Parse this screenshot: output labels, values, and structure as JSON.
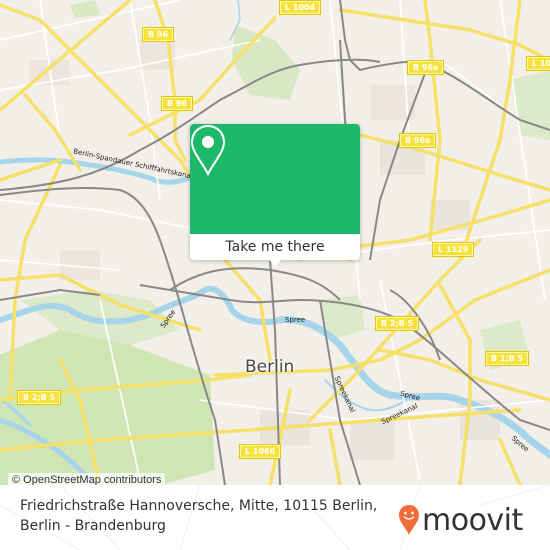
{
  "map": {
    "city_label": "Berlin",
    "attribution": "© OpenStreetMap contributors",
    "road_labels": [
      {
        "id": "l1004",
        "text": "L 1004"
      },
      {
        "id": "b96-top",
        "text": "B 96"
      },
      {
        "id": "b96a-top",
        "text": "B 96a"
      },
      {
        "id": "l10-right",
        "text": "L 10"
      },
      {
        "id": "b96-mid",
        "text": "B 96"
      },
      {
        "id": "b96a-mid",
        "text": "B 96a"
      },
      {
        "id": "l1129",
        "text": "L 1129"
      },
      {
        "id": "b2b5-center",
        "text": "B 2;B 5"
      },
      {
        "id": "b1b5",
        "text": "B 1;B 5"
      },
      {
        "id": "b2b5-left",
        "text": "B 2;B 5"
      },
      {
        "id": "l1066",
        "text": "L 1066"
      }
    ],
    "water_labels": {
      "canal": "Berlin-Spandauer Schifffahrtskanal",
      "spree_west": "Spree",
      "spree_center": "Spree",
      "spree_mid": "Spree",
      "spreekanal_1": "Spreekanal",
      "spreekanal_2": "Spreekanal",
      "spree_east": "Spree"
    }
  },
  "popup": {
    "icon": "location-pin-icon",
    "button_label": "Take me there",
    "color": "#1db86a"
  },
  "footer": {
    "address_line1": "Friedrichstraße Hannoversche, Mitte, 10115 Berlin,",
    "address_line2": "Berlin - Brandenburg",
    "brand": "moovit",
    "brand_color": "#f26b3a"
  }
}
